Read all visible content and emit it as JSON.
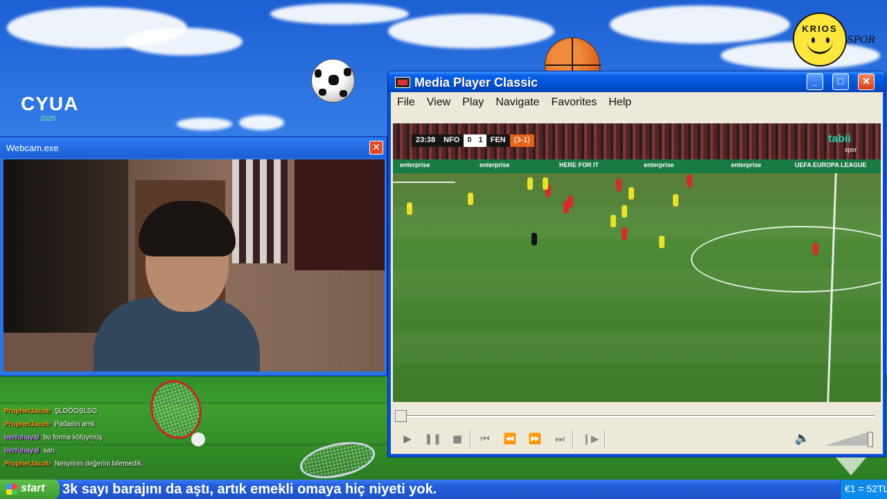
{
  "desktop": {
    "brand_left": "CYUA",
    "brand_left_year": "2020",
    "brand_right": "KRIOS",
    "brand_right_suffix": "SPOR"
  },
  "webcam_window": {
    "title": "Webcam.exe",
    "close_glyph": "✕"
  },
  "media_player": {
    "title": "Media Player Classic",
    "menu": [
      "File",
      "View",
      "Play",
      "Navigate",
      "Favorites",
      "Help"
    ],
    "title_buttons": {
      "minimize": "_",
      "maximize": "□",
      "close": "✕"
    },
    "video": {
      "scorebug": {
        "clock": "23:38",
        "home": "NFO",
        "home_score": "0",
        "away_score": "1",
        "away": "FEN",
        "aggregate": "(3-1)"
      },
      "broadcaster": "tabii",
      "broadcaster_sub": "spor",
      "adboards": [
        "enterprise",
        "enterprise",
        "HERE FOR IT",
        "enterprise",
        "enterprise",
        "UEFA EUROPA LEAGUE"
      ]
    },
    "seek_position": 0.0,
    "volume_level": 1.0,
    "controls_icons": [
      "play-icon",
      "pause-icon",
      "stop-icon",
      "skip-back-icon",
      "rewind-icon",
      "fast-forward-icon",
      "skip-forward-icon",
      "frame-step-icon",
      "speaker-icon"
    ]
  },
  "chat": [
    {
      "user": "ProphetJacob",
      "color": "#ff9a1f",
      "message": "ŞLDÖGŞLSG"
    },
    {
      "user": "ProphetJacob",
      "color": "#ff9a1f",
      "message": "Patladın amk"
    },
    {
      "user": "berfuhayal",
      "color": "#c98cff",
      "message": "bu forma kötüymüş"
    },
    {
      "user": "berfuhayal",
      "color": "#c98cff",
      "message": "sarı"
    },
    {
      "user": "ProphetJacob",
      "color": "#ff9a1f",
      "message": "Nesyrinin değerini bilemedik."
    }
  ],
  "taskbar": {
    "start_label": "start",
    "ticker": "3k sayı barajını da aştı, artık emekli omaya hiç niyeti yok.",
    "tray_text": "€1 = 52TL"
  }
}
